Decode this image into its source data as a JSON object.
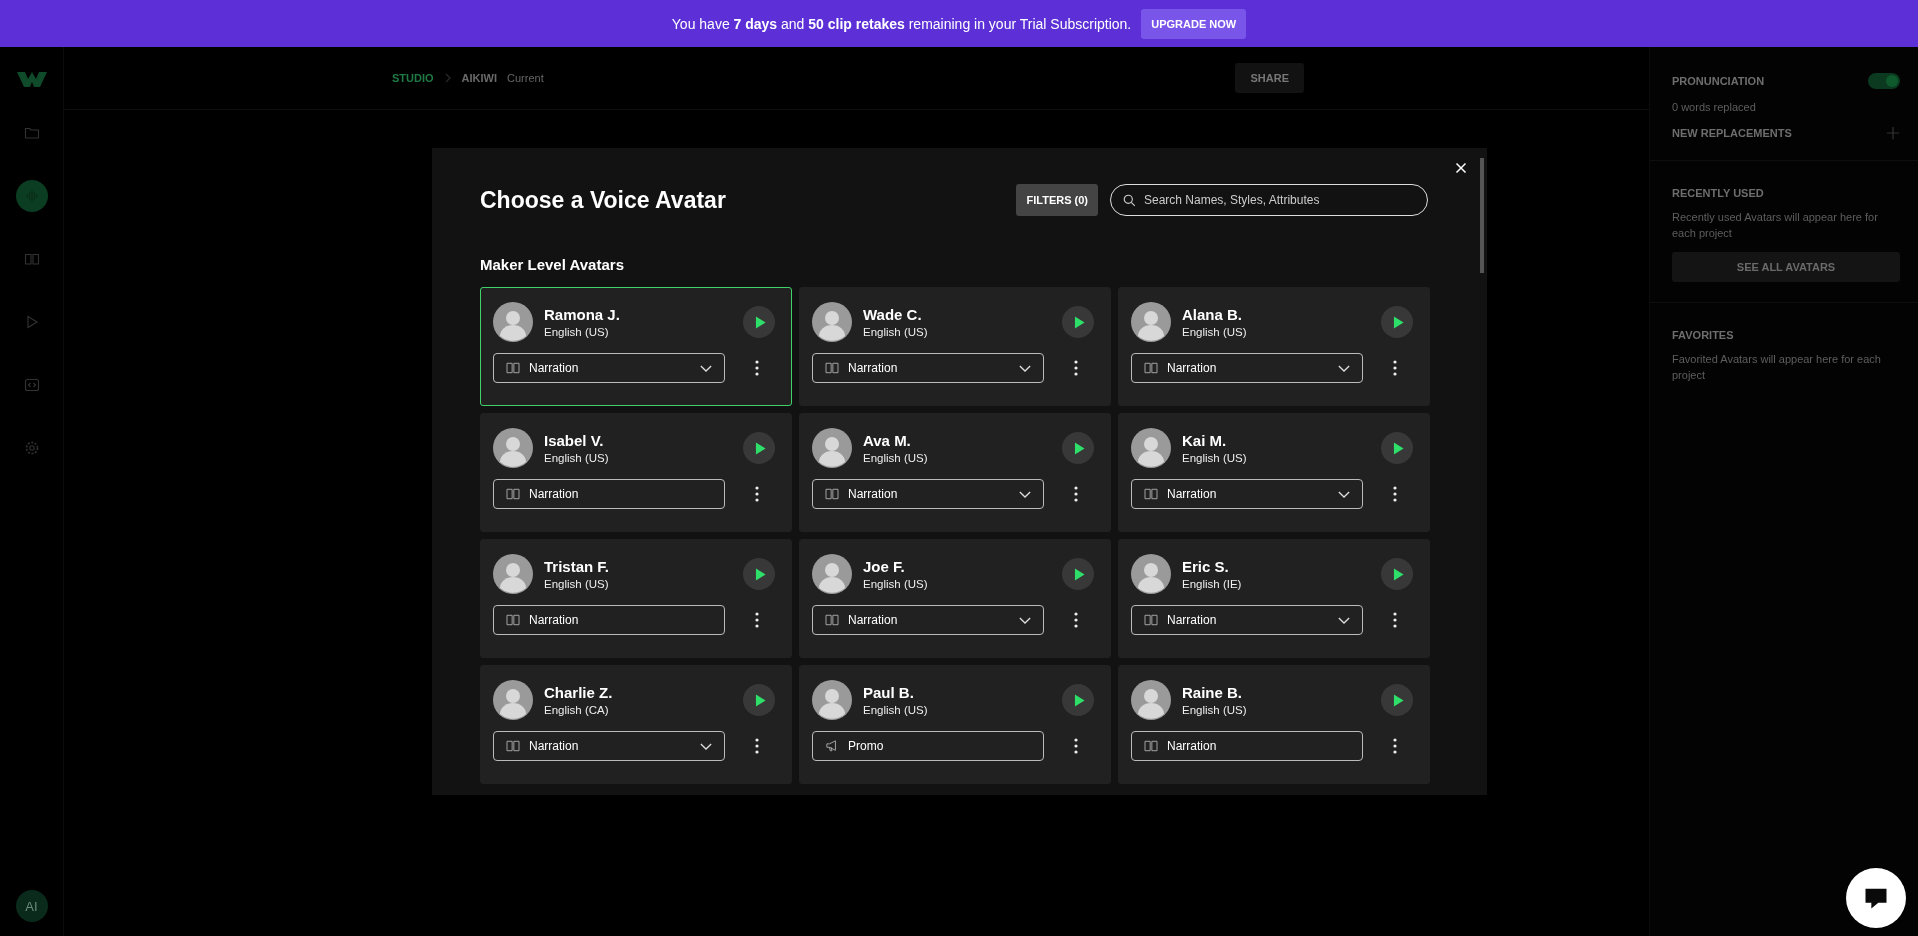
{
  "banner": {
    "message": "You have **7 days** and **50 clip retakes** remaining in your Trial Subscription.",
    "button": "UPGRADE NOW"
  },
  "sidebar": {
    "items": [
      {
        "kind": "folder",
        "selected": false
      },
      {
        "kind": "waveform",
        "selected": true
      },
      {
        "kind": "book",
        "selected": false
      },
      {
        "kind": "play",
        "selected": false
      },
      {
        "kind": "code",
        "selected": false
      },
      {
        "kind": "gear",
        "selected": false
      }
    ],
    "user_initials": "AI"
  },
  "breadcrumb": [
    {
      "label": "STUDIO",
      "kind": "root"
    },
    {
      "label": "AIKIWI",
      "kind": "project"
    },
    {
      "label": "Current",
      "kind": "version"
    }
  ],
  "share_button": "SHARE",
  "right_panel": {
    "pronunciation": {
      "title": "PRONUNCIATION",
      "on": true,
      "note": "0 words replaced",
      "new_replacements": "NEW REPLACEMENTS"
    },
    "recently_used": {
      "title": "RECENTLY USED",
      "note": "Recently used Avatars will appear here for each project",
      "button": "SEE ALL AVATARS"
    },
    "favorites": {
      "title": "FAVORITES",
      "note": "Favorited Avatars will appear here for each project"
    }
  },
  "modal": {
    "title": "Choose a Voice Avatar",
    "filters_button": "FILTERS (0)",
    "search_placeholder": "Search Names, Styles, Attributes",
    "section_title": "Maker Level Avatars",
    "avatars": [
      {
        "name": "Ramona J.",
        "language": "English (US)",
        "style": "Narration",
        "kind": "book",
        "expandable": true,
        "selected": true
      },
      {
        "name": "Wade C.",
        "language": "English (US)",
        "style": "Narration",
        "kind": "book",
        "expandable": true,
        "selected": false
      },
      {
        "name": "Alana B.",
        "language": "English (US)",
        "style": "Narration",
        "kind": "book",
        "expandable": true,
        "selected": false
      },
      {
        "name": "Isabel V.",
        "language": "English (US)",
        "style": "Narration",
        "kind": "book",
        "expandable": false,
        "selected": false
      },
      {
        "name": "Ava M.",
        "language": "English (US)",
        "style": "Narration",
        "kind": "book",
        "expandable": true,
        "selected": false
      },
      {
        "name": "Kai M.",
        "language": "English (US)",
        "style": "Narration",
        "kind": "book",
        "expandable": true,
        "selected": false
      },
      {
        "name": "Tristan F.",
        "language": "English (US)",
        "style": "Narration",
        "kind": "book",
        "expandable": false,
        "selected": false
      },
      {
        "name": "Joe F.",
        "language": "English (US)",
        "style": "Narration",
        "kind": "book",
        "expandable": true,
        "selected": false
      },
      {
        "name": "Eric S.",
        "language": "English (IE)",
        "style": "Narration",
        "kind": "book",
        "expandable": true,
        "selected": false
      },
      {
        "name": "Charlie Z.",
        "language": "English (CA)",
        "style": "Narration",
        "kind": "book",
        "expandable": true,
        "selected": false
      },
      {
        "name": "Paul B.",
        "language": "English (US)",
        "style": "Promo",
        "kind": "megaphone",
        "expandable": false,
        "selected": false
      },
      {
        "name": "Raine B.",
        "language": "English (US)",
        "style": "Narration",
        "kind": "book",
        "expandable": false,
        "selected": false
      }
    ]
  }
}
